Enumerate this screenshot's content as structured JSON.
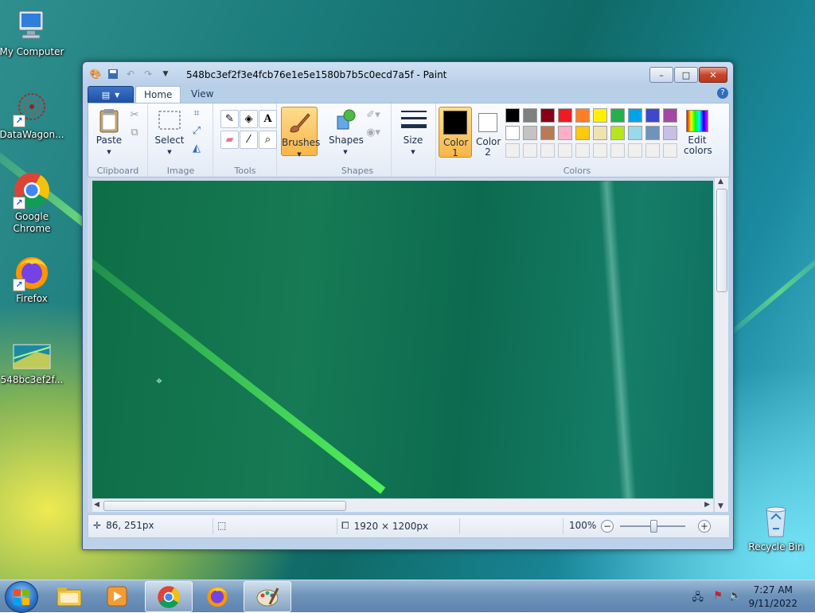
{
  "desktop": {
    "icons": [
      {
        "label": "My Computer",
        "icon": "computer-icon"
      },
      {
        "label": "DataWagon...",
        "icon": "datawagon-icon"
      },
      {
        "label": "Google Chrome",
        "icon": "chrome-icon"
      },
      {
        "label": "Firefox",
        "icon": "firefox-icon"
      },
      {
        "label": "548bc3ef2f...",
        "icon": "image-file-icon"
      },
      {
        "label": "Recycle Bin",
        "icon": "recycle-bin-icon"
      }
    ]
  },
  "window": {
    "title": "548bc3ef2f3e4fcb76e1e5e1580b7b5c0ecd7a5f - Paint",
    "controls": {
      "minimize": "–",
      "maximize": "□",
      "close": "✕"
    }
  },
  "ribbon": {
    "tabs": [
      {
        "label": "Home",
        "active": true
      },
      {
        "label": "View",
        "active": false
      }
    ],
    "groups": {
      "clipboard": {
        "label": "Clipboard",
        "paste": "Paste"
      },
      "image": {
        "label": "Image",
        "select": "Select"
      },
      "tools": {
        "label": "Tools"
      },
      "brushes": {
        "label": "Brushes"
      },
      "shapes": {
        "label": "Shapes",
        "shapes_btn": "Shapes"
      },
      "size": {
        "label": "Size"
      },
      "colors": {
        "label": "Colors",
        "color1": "Color 1",
        "color2": "Color 2",
        "edit_colors": "Edit colors",
        "color1_value": "#000000",
        "color2_value": "#ffffff",
        "palette_row1": [
          "#000000",
          "#7f7f7f",
          "#880015",
          "#ed1c24",
          "#ff7f27",
          "#fff200",
          "#22b14c",
          "#00a2e8",
          "#3f48cc",
          "#a349a4"
        ],
        "palette_row2": [
          "#ffffff",
          "#c3c3c3",
          "#b97a57",
          "#ffaec9",
          "#ffc90e",
          "#efe4b0",
          "#b5e61d",
          "#99d9ea",
          "#7092be",
          "#c8bfe7"
        ],
        "palette_row3": [
          "#f0f0f0",
          "#f0f0f0",
          "#f0f0f0",
          "#f0f0f0",
          "#f0f0f0",
          "#f0f0f0",
          "#f0f0f0",
          "#f0f0f0",
          "#f0f0f0",
          "#f0f0f0"
        ]
      }
    }
  },
  "status": {
    "cursor_pos": "86, 251px",
    "image_size": "1920 × 1200px",
    "zoom": "100%"
  },
  "taskbar": {
    "apps": [
      "explorer-icon",
      "media-player-icon",
      "chrome-icon",
      "firefox-icon",
      "paint-icon"
    ],
    "time": "7:27 AM",
    "date": "9/11/2022"
  },
  "colors": {
    "accent": "#1f4fa1",
    "brushes_highlight": "#f8b64a"
  }
}
